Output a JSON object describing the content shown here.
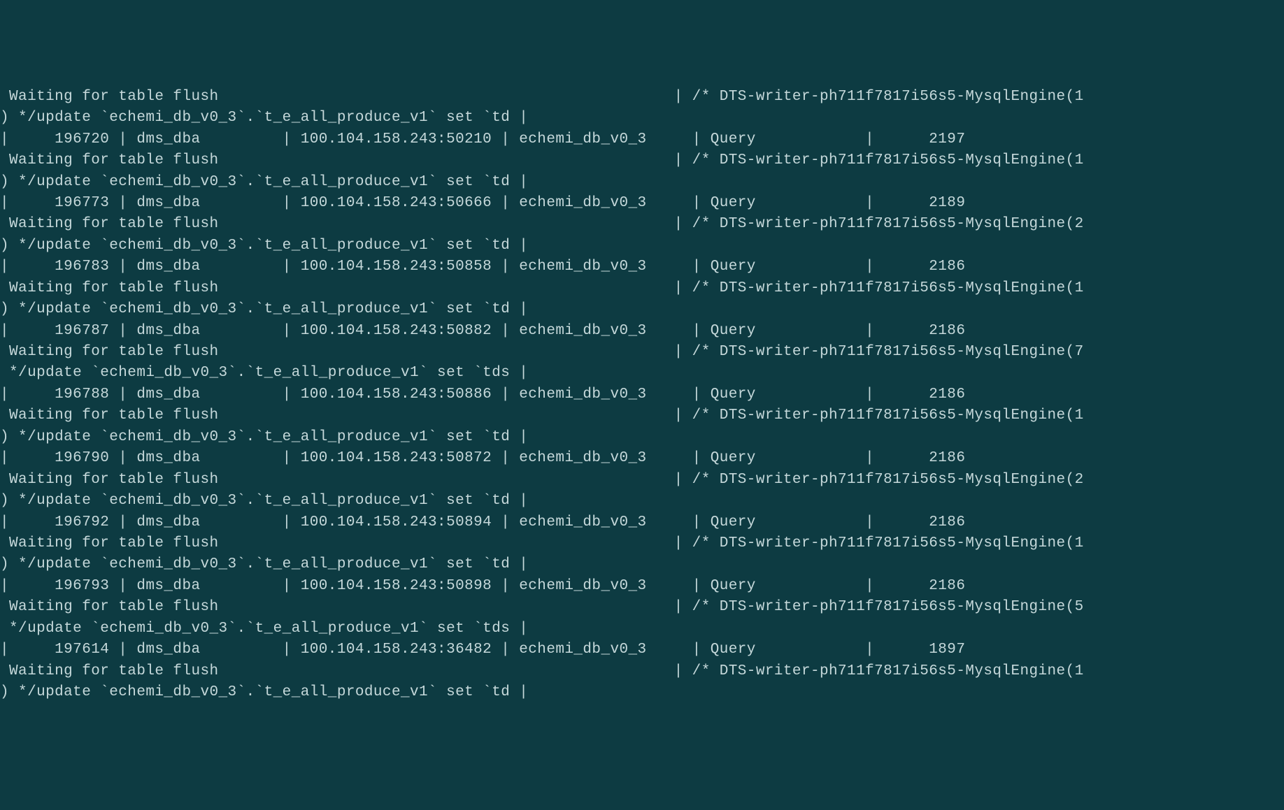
{
  "rows": [
    {
      "id": "196720",
      "user": "dms_dba",
      "host": "100.104.158.243:50210",
      "db": "echemi_db_v0_3",
      "cmd": "Query",
      "time": "2197",
      "engine": "1"
    },
    {
      "id": "196773",
      "user": "dms_dba",
      "host": "100.104.158.243:50666",
      "db": "echemi_db_v0_3",
      "cmd": "Query",
      "time": "2189",
      "engine": "2"
    },
    {
      "id": "196783",
      "user": "dms_dba",
      "host": "100.104.158.243:50858",
      "db": "echemi_db_v0_3",
      "cmd": "Query",
      "time": "2186",
      "engine": "1"
    },
    {
      "id": "196787",
      "user": "dms_dba",
      "host": "100.104.158.243:50882",
      "db": "echemi_db_v0_3",
      "cmd": "Query",
      "time": "2186",
      "engine": "7"
    },
    {
      "id": "196788",
      "user": "dms_dba",
      "host": "100.104.158.243:50886",
      "db": "echemi_db_v0_3",
      "cmd": "Query",
      "time": "2186",
      "engine": "1"
    },
    {
      "id": "196790",
      "user": "dms_dba",
      "host": "100.104.158.243:50872",
      "db": "echemi_db_v0_3",
      "cmd": "Query",
      "time": "2186",
      "engine": "2"
    },
    {
      "id": "196792",
      "user": "dms_dba",
      "host": "100.104.158.243:50894",
      "db": "echemi_db_v0_3",
      "cmd": "Query",
      "time": "2186",
      "engine": "1"
    },
    {
      "id": "196793",
      "user": "dms_dba",
      "host": "100.104.158.243:50898",
      "db": "echemi_db_v0_3",
      "cmd": "Query",
      "time": "2186",
      "engine": "5"
    },
    {
      "id": "197614",
      "user": "dms_dba",
      "host": "100.104.158.243:36482",
      "db": "echemi_db_v0_3",
      "cmd": "Query",
      "time": "1897",
      "engine": "1"
    }
  ],
  "waiting_msg": "Waiting for table flush",
  "dts_prefix": "/* DTS-writer-ph711f7817i56s5-MysqlEngine(",
  "update_td": ") */update `echemi_db_v0_3`.`t_e_all_produce_v1` set `td |",
  "update_tds": " */update `echemi_db_v0_3`.`t_e_all_produce_v1` set `tds |",
  "first_waiting": " Waiting for table flush                                                  | /* DTS-writer-ph711f7817i56s5-MysqlEngine(1",
  "first_update": ") */update `echemi_db_v0_3`.`t_e_all_produce_v1` set `td |",
  "tds_indices": [
    3,
    7
  ]
}
